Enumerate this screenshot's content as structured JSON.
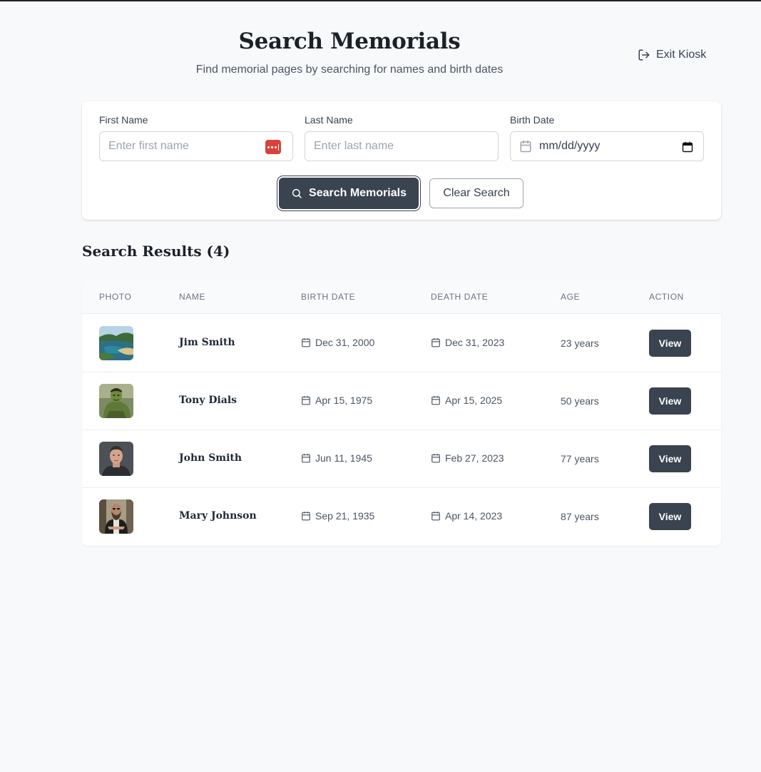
{
  "header": {
    "title": "Search Memorials",
    "subtitle": "Find memorial pages by searching for names and birth dates",
    "exit_label": "Exit Kiosk"
  },
  "search": {
    "first_name_label": "First Name",
    "first_name_placeholder": "Enter first name",
    "last_name_label": "Last Name",
    "last_name_placeholder": "Enter last name",
    "birth_date_label": "Birth Date",
    "birth_date_value": "mm/dd/yyyy",
    "search_button": "Search Memorials",
    "clear_button": "Clear Search"
  },
  "results": {
    "heading": "Search Results (4)",
    "columns": [
      "PHOTO",
      "NAME",
      "BIRTH DATE",
      "DEATH DATE",
      "AGE",
      "ACTION"
    ],
    "rows": [
      {
        "name": "Jim Smith",
        "birth": "Dec 31, 2000",
        "death": "Dec 31, 2023",
        "age": "23 years",
        "action": "View",
        "photo": "landscape-photo"
      },
      {
        "name": "Tony Dials",
        "birth": "Apr 15, 1975",
        "death": "Apr 15, 2025",
        "age": "50 years",
        "action": "View",
        "photo": "hulk-photo"
      },
      {
        "name": "John Smith",
        "birth": "Jun 11, 1945",
        "death": "Feb 27, 2023",
        "age": "77 years",
        "action": "View",
        "photo": "man-portrait-photo"
      },
      {
        "name": "Mary Johnson",
        "birth": "Sep 21, 1935",
        "death": "Apr 14, 2023",
        "age": "87 years",
        "action": "View",
        "photo": "bearded-man-photo"
      }
    ]
  },
  "colors": {
    "primary": "#3a4350",
    "background": "#f8f9fb",
    "password_icon": "#d9423b"
  }
}
